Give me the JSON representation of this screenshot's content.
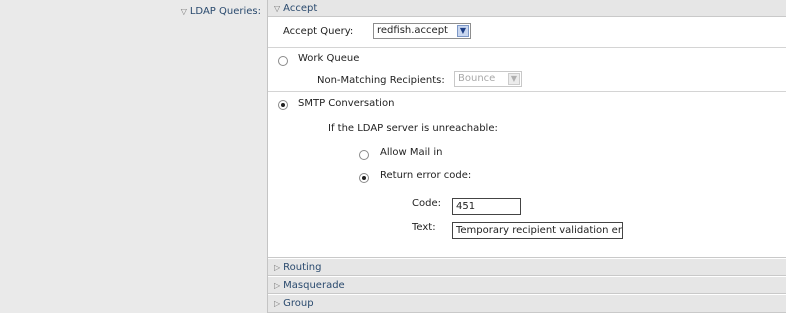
{
  "ldap_queries_label": "LDAP Queries:",
  "accept_section": {
    "header": "Accept",
    "accept_query_label": "Accept Query:",
    "accept_query_value": "redfish.accept",
    "work_queue_label": "Work Queue",
    "non_matching_label": "Non-Matching Recipients:",
    "non_matching_value": "Bounce",
    "smtp_conversation_label": "SMTP Conversation",
    "unreachable_label": "If the LDAP server is unreachable:",
    "allow_mail_label": "Allow Mail in",
    "return_error_label": "Return error code:",
    "code_label": "Code:",
    "code_value": "451",
    "text_label": "Text:",
    "text_value": "Temporary recipient validation er"
  },
  "collapsed_sections": [
    "Routing",
    "Masquerade",
    "Group"
  ],
  "state": {
    "work_queue_selected": false,
    "smtp_conversation_selected": true,
    "allow_mail_selected": false,
    "return_error_selected": true
  },
  "icons": {
    "expanded": "triangle-down-icon",
    "collapsed": "triangle-right-icon",
    "dropdown": "chevron-down-icon"
  },
  "colors": {
    "label_blue": "#2a4a6e",
    "left_pane_bg": "#eaeaea",
    "header_bg": "#e6e6e6"
  }
}
